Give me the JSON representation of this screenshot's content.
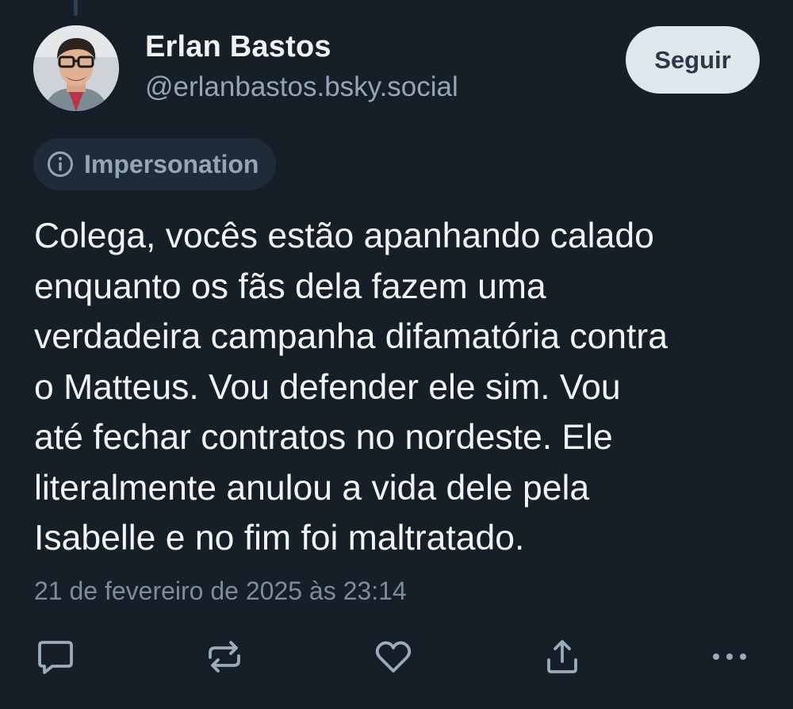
{
  "post": {
    "author": {
      "display_name": "Erlan Bastos",
      "handle": "@erlanbastos.bsky.social",
      "avatar_icon": "profile-photo"
    },
    "follow_button_label": "Seguir",
    "moderation_label": {
      "icon": "info-icon",
      "text": "Impersonation"
    },
    "text_lines": [
      "Colega, vocês estão apanhando calado",
      "enquanto os fãs dela fazem uma",
      "verdadeira campanha difamatória contra",
      "o Matteus. Vou defender ele sim. Vou",
      "até fechar contratos no nordeste. Ele",
      "literalmente anulou a vida dele pela",
      "Isabelle e no fim foi maltratado."
    ],
    "timestamp": "21 de fevereiro de 2025 às 23:14",
    "actions": [
      "reply-icon",
      "repost-icon",
      "like-icon",
      "share-icon",
      "more-options-icon"
    ]
  },
  "colors": {
    "background": "#161e27",
    "text_primary": "#f1f3f5",
    "text_secondary": "#93a5b7",
    "button_bg": "#dfe6ec",
    "chip_bg": "#1e2b38"
  }
}
